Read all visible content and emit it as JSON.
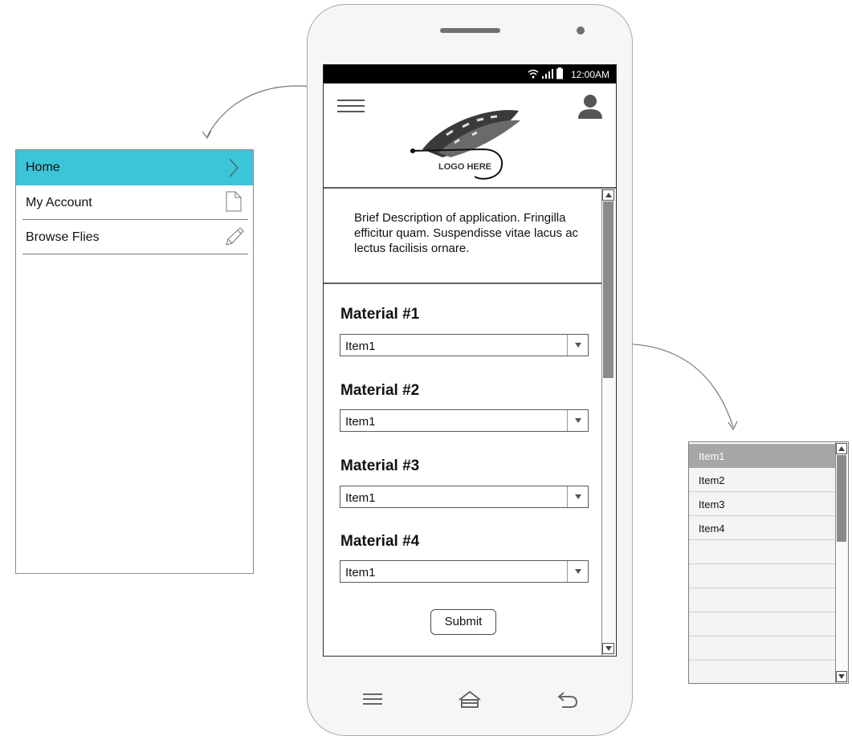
{
  "side_menu": {
    "items": [
      {
        "label": "Home",
        "icon": "chevron-right-icon",
        "active": true
      },
      {
        "label": "My Account",
        "icon": "document-icon"
      },
      {
        "label": "Browse Flies",
        "icon": "pencil-icon"
      }
    ],
    "active_color": "#3cc4d8"
  },
  "phone": {
    "status_bar": {
      "time": "12:00AM",
      "icons": "wifi-icon signal-icon battery-icon"
    },
    "header": {
      "menu_icon": "hamburger-icon",
      "logo_text": "LOGO HERE",
      "logo_icon": "fly-lure-icon",
      "profile_icon": "user-icon"
    },
    "description": "Brief Description of application. Fringilla efficitur quam. Suspendisse vitae lacus ac lectus facilisis ornare.",
    "materials": [
      {
        "title": "Material #1",
        "value": "Item1"
      },
      {
        "title": "Material #2",
        "value": "Item1"
      },
      {
        "title": "Material #3",
        "value": "Item1"
      },
      {
        "title": "Material #4",
        "value": "Item1"
      }
    ],
    "submit_label": "Submit",
    "nav": {
      "menu_icon": "menu-icon",
      "home_icon": "home-icon",
      "back_icon": "back-icon"
    }
  },
  "dropdown_list": {
    "items": [
      "Item1",
      "Item2",
      "Item3",
      "Item4",
      "",
      "",
      "",
      "",
      "",
      ""
    ],
    "selected_index": 0
  }
}
